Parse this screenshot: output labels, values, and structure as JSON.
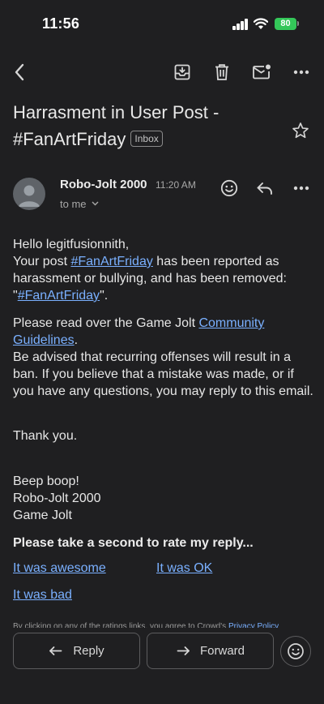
{
  "status_bar": {
    "time": "11:56",
    "battery": "80"
  },
  "email": {
    "subject": "Harrasment in User Post - #FanArtFriday",
    "label": "Inbox",
    "sender": "Robo-Jolt 2000",
    "time": "11:20 AM",
    "recipient": "to me"
  },
  "body": {
    "greeting": "Hello legitfusionnith,",
    "p1_pre": "Your post ",
    "p1_link1": "#FanArtFriday",
    "p1_mid": " has been reported as harassment or bullying, and has been removed: \"",
    "p1_link2": "#FanArtFriday",
    "p1_post": "\".",
    "p2_pre": "Please read over the Game Jolt ",
    "p2_link": "Community Guidelines",
    "p2_post": ".",
    "p3": "Be advised that recurring offenses will result in a ban. If you believe that a mistake was made, or if you have any questions, you may reply to this email.",
    "thanks": "Thank you.",
    "sig1": "Beep boop!",
    "sig2": "Robo-Jolt 2000",
    "sig3": "Game Jolt"
  },
  "rating": {
    "heading": "Please take a second to rate my reply...",
    "awesome": "It was awesome",
    "ok": "It was OK",
    "bad": "It was bad",
    "disclaimer_pre": "By clicking on any of the ratings links, you agree to Crowd's ",
    "disclaimer_link": "Privacy Policy"
  },
  "actions": {
    "reply": "Reply",
    "forward": "Forward"
  },
  "colors": {
    "background": "#1f1f21",
    "link": "#7ab0ff",
    "battery": "#34c759"
  },
  "icons": [
    "back-icon",
    "archive-icon",
    "delete-icon",
    "mark-unread-icon",
    "more-icon",
    "star-icon",
    "emoji-icon",
    "reply-icon",
    "forward-icon"
  ]
}
